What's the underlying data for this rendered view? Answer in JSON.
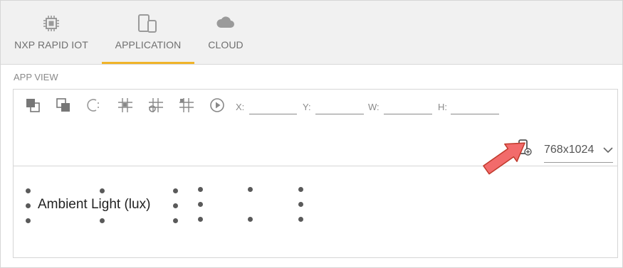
{
  "tabs": [
    {
      "label": "NXP RAPID IOT",
      "icon": "chip-icon",
      "active": false
    },
    {
      "label": "APPLICATION",
      "icon": "devices-icon",
      "active": true
    },
    {
      "label": "CLOUD",
      "icon": "cloud-icon",
      "active": false
    }
  ],
  "app_view": {
    "title": "APP VIEW",
    "coords": {
      "x_label": "X:",
      "y_label": "Y:",
      "w_label": "W:",
      "h_label": "H:"
    },
    "resolution": "768x1024"
  },
  "widget": {
    "label": "Ambient Light (lux)"
  },
  "colors": {
    "accent": "#f0b429",
    "tabbar_bg": "#f1f1f1",
    "annotation_arrow": "#f26b6b"
  }
}
